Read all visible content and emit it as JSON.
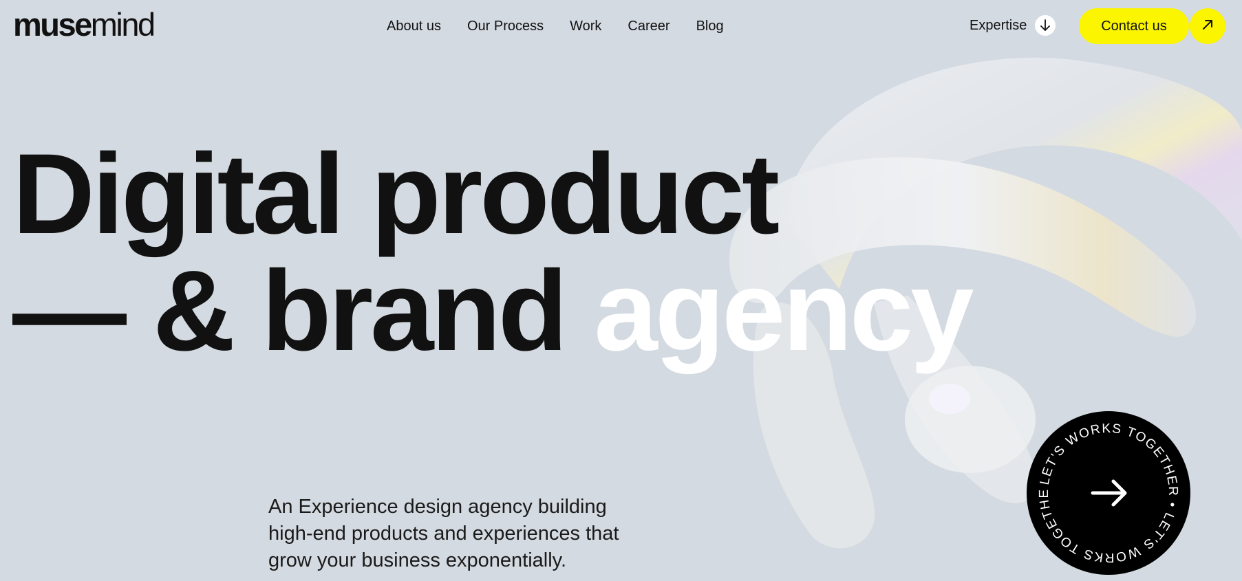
{
  "header": {
    "logo_bold": "muse",
    "logo_thin": "mind",
    "nav": [
      "About us",
      "Our Process",
      "Work",
      "Career",
      "Blog"
    ],
    "expertise_label": "Expertise",
    "contact_label": "Contact us"
  },
  "hero": {
    "line1": "Digital product",
    "line2_dark": "— & brand",
    "line2_accent": "agency",
    "tagline": "An Experience design agency building high-end products and experiences that grow your business exponentially."
  },
  "badge": {
    "ring_text": "LET'S WORKS TOGETHER • LET'S WORKS TOGETHER • "
  },
  "colors": {
    "background": "#d4dae1",
    "accent_yellow": "#fbf500",
    "text": "#111111",
    "headline_accent": "#ffffff"
  },
  "icons": {
    "expertise": "arrow-down-icon",
    "contact": "arrow-up-right-icon",
    "badge": "arrow-right-icon"
  }
}
